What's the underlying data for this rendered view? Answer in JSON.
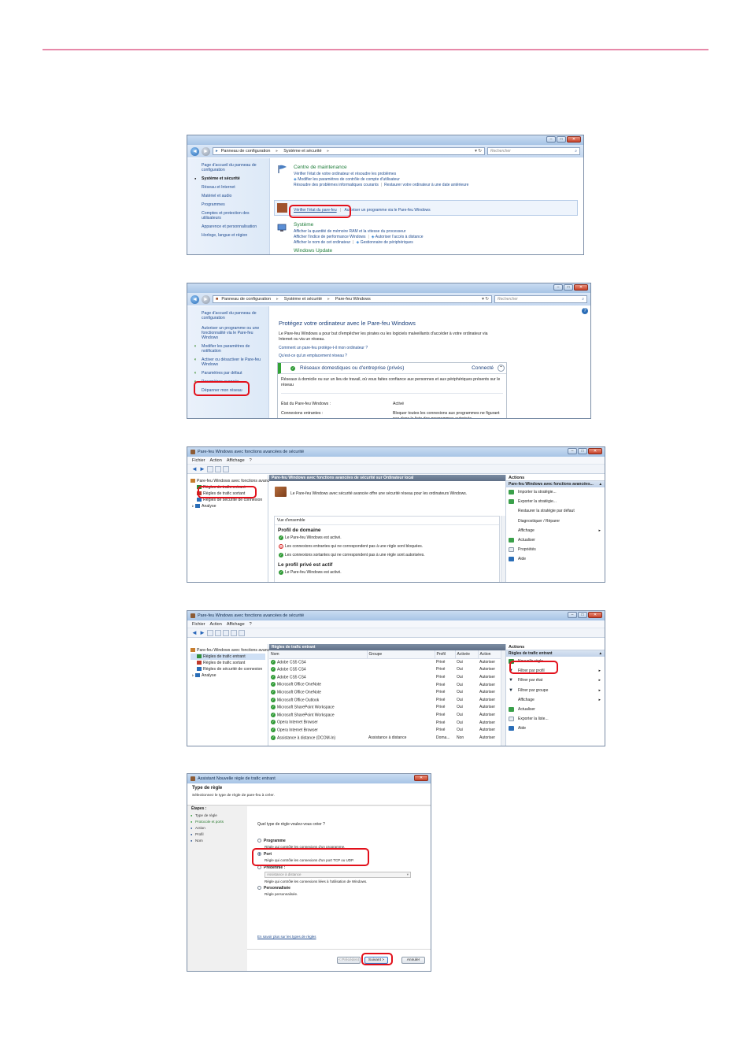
{
  "colors": {
    "rule": "#e789a9",
    "highlight": "#e2101b",
    "link": "#1f4b8f",
    "headingGreen": "#1e7d3a"
  },
  "win1": {
    "breadcrumb": [
      "Panneau de configuration",
      "Système et sécurité"
    ],
    "search_placeholder": "Rechercher",
    "sidebar": [
      "Page d'accueil du panneau de configuration",
      "Système et sécurité",
      "Réseau et Internet",
      "Matériel et audio",
      "Programmes",
      "Comptes et protection des utilisateurs",
      "Apparence et personnalisation",
      "Horloge, langue et région"
    ],
    "maint_title": "Centre de maintenance",
    "maint_links": [
      "Vérifier l'état de votre ordinateur et résoudre les problèmes",
      "Modifier les paramètres de contrôle de compte d'utilisateur",
      "Résoudre des problèmes informatiques courants",
      "Restaurer votre ordinateur à une date antérieure"
    ],
    "fw_links": [
      "Vérifier l'état du pare-feu",
      "Autoriser un programme via le Pare-feu Windows"
    ],
    "sys_title": "Système",
    "sys_links": [
      "Afficher la quantité de mémoire RAM et la vitesse du processeur",
      "Afficher l'indice de performance Windows",
      "Autoriser l'accès à distance",
      "Afficher le nom de cet ordinateur",
      "Gestionnaire de périphériques"
    ],
    "next_section": "Windows Update"
  },
  "win2": {
    "breadcrumb": [
      "Panneau de configuration",
      "Système et sécurité",
      "Pare-feu Windows"
    ],
    "search_placeholder": "Rechercher",
    "sidebar": [
      "Page d'accueil du panneau de configuration",
      "Autoriser un programme ou une fonctionnalité via le Pare-feu Windows",
      "Modifier les paramètres de notification",
      "Activer ou désactiver le Pare-feu Windows",
      "Paramètres par défaut",
      "Paramètres avancés",
      "Dépanner mon réseau"
    ],
    "heading": "Protégez votre ordinateur avec le Pare-feu Windows",
    "intro": "Le Pare-feu Windows a pour but d'empêcher les pirates ou les logiciels malveillants d'accéder à votre ordinateur via Internet ou via un réseau.",
    "link1": "Comment un pare-feu protège-t-il mon ordinateur ?",
    "link2": "Qu'est-ce qu'un emplacement réseau ?",
    "network_title": "Réseaux domestiques ou d'entreprise (privés)",
    "network_status": "Connecté",
    "network_desc": "Réseaux à domicile ou sur un lieu de travail, où vous faites confiance aux personnes et aux périphériques présents sur le réseau",
    "state_label": "État du Pare-feu Windows :",
    "state_value": "Activé",
    "incoming_label": "Connexions entrantes :",
    "incoming_value": "Bloquer toutes les connexions aux programmes ne figurant pas dans la liste des programmes autorisés"
  },
  "win3": {
    "title": "Pare-feu Windows avec fonctions avancées de sécurité",
    "menu": [
      "Fichier",
      "Action",
      "Affichage",
      "?"
    ],
    "tree": [
      "Pare-feu Windows avec fonctions avancées de sécurité",
      "Règles de trafic entrant",
      "Règles de trafic sortant",
      "Règles de sécurité de connexion",
      "Analyse"
    ],
    "center_header": "Pare-feu Windows avec fonctions avancées de sécurité sur Ordinateur local",
    "intro": "Le Pare-feu Windows avec sécurité avancée offre une sécurité réseau pour les ordinateurs Windows.",
    "overview": "Vue d'ensemble",
    "profile1": "Profil de domaine",
    "p1_items": [
      "Le Pare-feu Windows est activé.",
      "Les connexions entrantes qui ne correspondent pas à une règle sont bloquées.",
      "Les connexions sortantes qui ne correspondent pas à une règle sont autorisées."
    ],
    "profile2": "Le profil privé est actif",
    "p2_items": [
      "Le Pare-feu Windows est activé."
    ],
    "actions_title": "Actions",
    "actions_sub": "Pare-feu Windows avec fonctions avancées...",
    "actions": [
      "Importer la stratégie...",
      "Exporter la stratégie...",
      "Restaurer la stratégie par défaut",
      "Diagnostiquer / Réparer",
      "Affichage",
      "Actualiser",
      "Propriétés",
      "Aide"
    ]
  },
  "win4": {
    "title": "Pare-feu Windows avec fonctions avancées de sécurité",
    "menu": [
      "Fichier",
      "Action",
      "Affichage",
      "?"
    ],
    "tree": [
      "Pare-feu Windows avec fonctions avancées de sécurité",
      "Règles de trafic entrant",
      "Règles de trafic sortant",
      "Règles de sécurité de connexion",
      "Analyse"
    ],
    "center_header": "Règles de trafic entrant",
    "columns": [
      "Nom",
      "Groupe",
      "Profil",
      "Activée",
      "Action"
    ],
    "rows": [
      [
        "Adobe CS5 CS4",
        "",
        "Privé",
        "Oui",
        "Autoriser"
      ],
      [
        "Adobe CS5 CS4",
        "",
        "Privé",
        "Oui",
        "Autoriser"
      ],
      [
        "Adobe CS5 CS4",
        "",
        "Privé",
        "Oui",
        "Autoriser"
      ],
      [
        "Microsoft Office OneNote",
        "",
        "Privé",
        "Oui",
        "Autoriser"
      ],
      [
        "Microsoft Office OneNote",
        "",
        "Privé",
        "Oui",
        "Autoriser"
      ],
      [
        "Microsoft Office Outlook",
        "",
        "Privé",
        "Oui",
        "Autoriser"
      ],
      [
        "Microsoft SharePoint Workspace",
        "",
        "Privé",
        "Oui",
        "Autoriser"
      ],
      [
        "Microsoft SharePoint Workspace",
        "",
        "Privé",
        "Oui",
        "Autoriser"
      ],
      [
        "Opera Internet Browser",
        "",
        "Privé",
        "Oui",
        "Autoriser"
      ],
      [
        "Opera Internet Browser",
        "",
        "Privé",
        "Oui",
        "Autoriser"
      ],
      [
        "Assistance à distance (DCOM-In)",
        "Assistance à distance",
        "Doma...",
        "Non",
        "Autoriser"
      ]
    ],
    "actions_title": "Actions",
    "actions_sub": "Règles de trafic entrant",
    "actions": [
      "Nouvelle règle...",
      "Filtrer par profil",
      "Filtrer par état",
      "Filtrer par groupe",
      "Affichage",
      "Actualiser",
      "Exporter la liste...",
      "Aide"
    ]
  },
  "win5": {
    "title": "Assistant Nouvelle règle de trafic entrant",
    "page_title": "Type de règle",
    "page_sub": "Sélectionnez le type de règle de pare-feu à créer.",
    "steps_title": "Étapes :",
    "steps": [
      "Type de règle",
      "Protocole et ports",
      "Action",
      "Profil",
      "Nom"
    ],
    "question": "Quel type de règle voulez-vous créer ?",
    "options": [
      {
        "label": "Programme",
        "desc": "Règle qui contrôle les connexions d'un programme."
      },
      {
        "label": "Port",
        "desc": "Règle qui contrôle les connexions d'un port TCP ou UDP."
      },
      {
        "label": "Prédéfinie :",
        "desc": "Règle qui contrôle les connexions liées à l'utilisation de Windows."
      },
      {
        "label": "Personnalisée",
        "desc": "Règle personnalisée."
      }
    ],
    "predefined_value": "Assistance à distance",
    "help_link": "En savoir plus sur les types de règles",
    "btn_prev": "< Précédent",
    "btn_next": "Suivant >",
    "btn_cancel": "Annuler"
  }
}
